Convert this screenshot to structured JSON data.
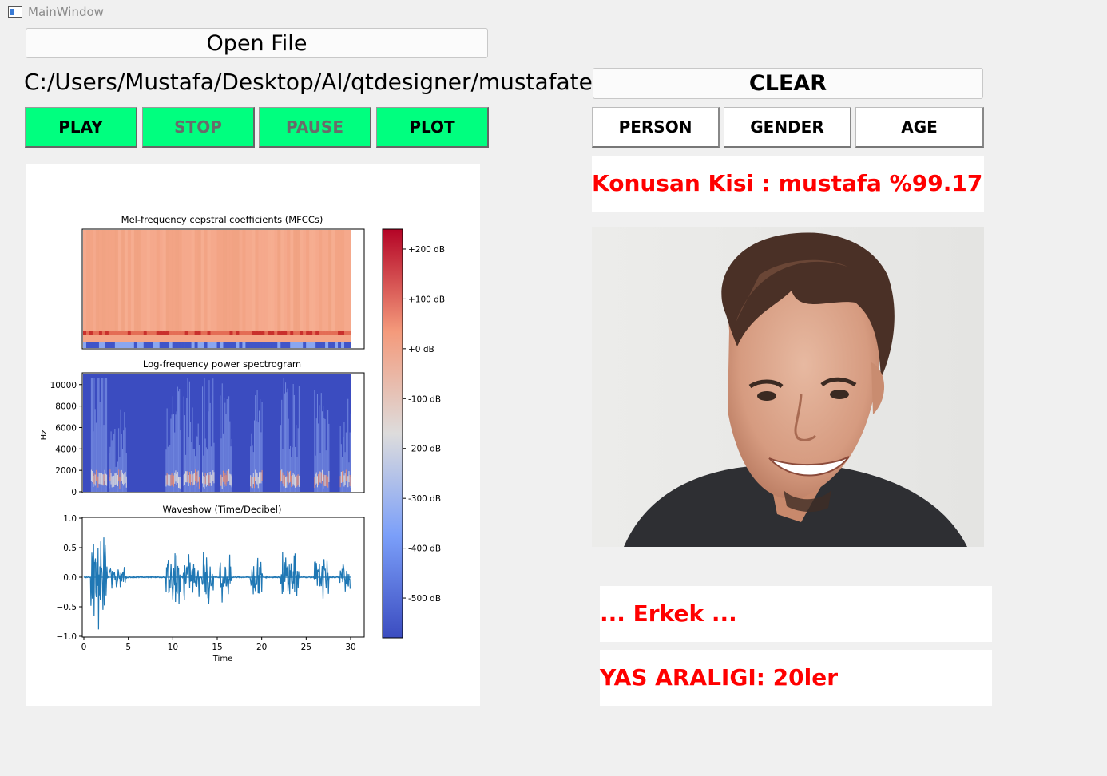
{
  "window": {
    "title": "MainWindow"
  },
  "toolbar": {
    "open_label": "Open File",
    "file_path": "C:/Users/Mustafa/Desktop/AI/qtdesigner/mustafatest.wav",
    "play_label": "PLAY",
    "stop_label": "STOP",
    "pause_label": "PAUSE",
    "plot_label": "PLOT"
  },
  "right_panel": {
    "clear_label": "CLEAR",
    "person_label": "PERSON",
    "gender_label": "GENDER",
    "age_label": "AGE",
    "speaker_result": "Konusan Kisi : mustafa %99.17",
    "gender_result": "... Erkek ...",
    "age_result": "YAS ARALIGI: 20ler"
  },
  "colors": {
    "accent_green": "#00ff7f",
    "result_red": "#ff0000"
  },
  "chart_data": [
    {
      "type": "heatmap",
      "title": "Mel-frequency cepstral coefficients (MFCCs)",
      "xlabel": "",
      "ylabel": "",
      "colorbar": {
        "ticks": [
          "+200 dB",
          "+100 dB",
          "+0 dB",
          "-100 dB",
          "-200 dB",
          "-300 dB",
          "-400 dB",
          "-500 dB"
        ],
        "range": [
          -580,
          240
        ],
        "colormap": "coolwarm"
      }
    },
    {
      "type": "heatmap",
      "title": "Log-frequency power spectrogram",
      "ylabel": "Hz",
      "yticks": [
        "0",
        "2000",
        "4000",
        "6000",
        "8000",
        "10000"
      ],
      "ylim": [
        0,
        11025
      ]
    },
    {
      "type": "line",
      "title": "Waveshow (Time/Decibel)",
      "xlabel": "Time",
      "xticks": [
        "0",
        "5",
        "10",
        "15",
        "20",
        "25",
        "30"
      ],
      "yticks": [
        "1.0",
        "0.5",
        "0.0",
        "−0.5",
        "−1.0"
      ],
      "xlim": [
        0,
        31
      ],
      "ylim": [
        -1.0,
        1.0
      ],
      "bursts": [
        {
          "start": 0.8,
          "end": 2.6,
          "amp": 0.92
        },
        {
          "start": 2.8,
          "end": 4.8,
          "amp": 0.2
        },
        {
          "start": 9.2,
          "end": 10.9,
          "amp": 0.55
        },
        {
          "start": 11.2,
          "end": 13.0,
          "amp": 0.5
        },
        {
          "start": 13.3,
          "end": 14.6,
          "amp": 0.48
        },
        {
          "start": 15.3,
          "end": 16.6,
          "amp": 0.45
        },
        {
          "start": 18.7,
          "end": 20.1,
          "amp": 0.42
        },
        {
          "start": 22.1,
          "end": 24.2,
          "amp": 0.48
        },
        {
          "start": 25.9,
          "end": 27.6,
          "amp": 0.38
        },
        {
          "start": 28.8,
          "end": 30.0,
          "amp": 0.3
        }
      ]
    }
  ]
}
